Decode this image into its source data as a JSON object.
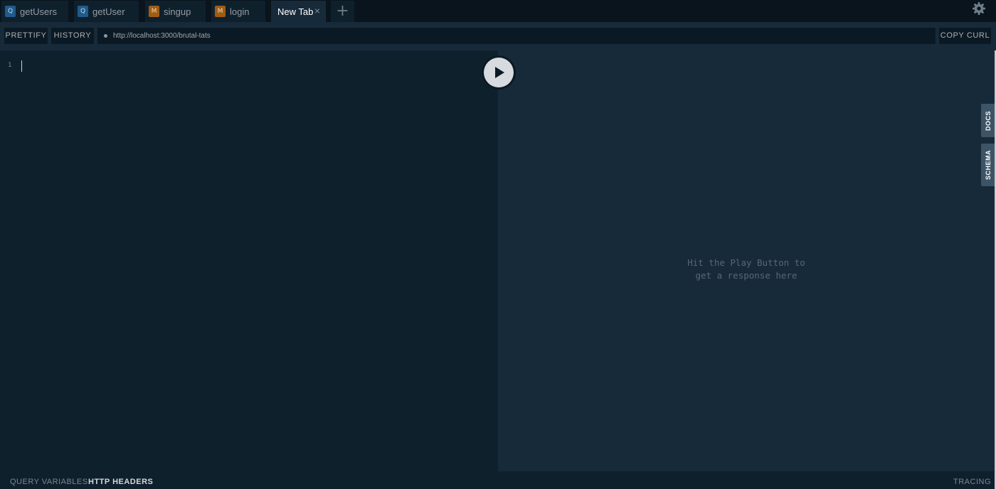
{
  "tabs": [
    {
      "badge": "Q",
      "title": "getUsers"
    },
    {
      "badge": "Q",
      "title": "getUser"
    },
    {
      "badge": "M",
      "title": "singup"
    },
    {
      "badge": "M",
      "title": "login"
    },
    {
      "title": "New Tab",
      "close": "×"
    }
  ],
  "add_tab": "+",
  "toolbar": {
    "prettify": "PRETTIFY",
    "history": "HISTORY",
    "endpoint": "http://localhost:3000/brutal-tats",
    "copy_curl": "COPY CURL"
  },
  "editor": {
    "line_number": "1"
  },
  "result": {
    "placeholder": "Hit the Play Button to\nget a response here"
  },
  "side_tabs": {
    "docs": "DOCS",
    "schema": "SCHEMA"
  },
  "bottom": {
    "query_variables": "QUERY VARIABLES",
    "http_headers": "HTTP HEADERS",
    "tracing": "TRACING"
  },
  "icons": {
    "settings": "gear-icon",
    "play": "play-icon",
    "add": "plus-icon",
    "close": "close-icon"
  },
  "colors": {
    "query_badge": "#1f5b8c",
    "mutation_badge": "#a05d12",
    "editor_bg": "#0f202d",
    "result_bg": "#172a3a",
    "side_tab_bg": "#3d5466"
  }
}
